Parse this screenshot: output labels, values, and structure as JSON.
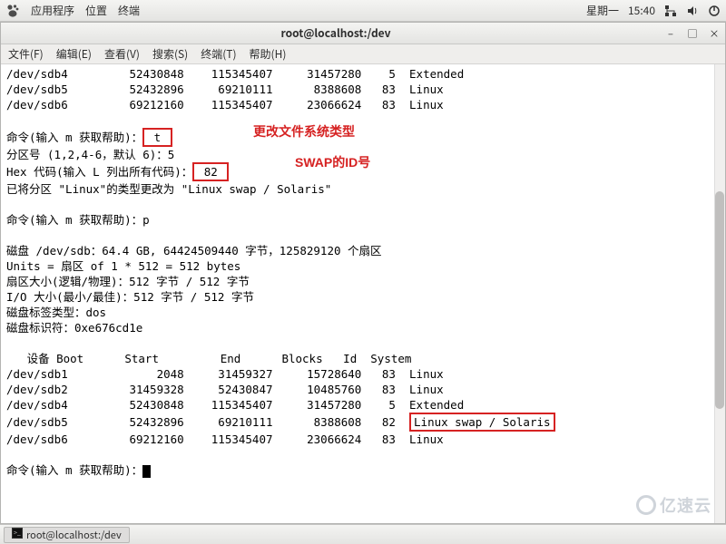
{
  "topbar": {
    "menus": [
      "应用程序",
      "位置",
      "终端"
    ],
    "day": "星期一",
    "time": "15:40"
  },
  "window": {
    "title": "root@localhost:/dev",
    "menubar": [
      "文件(F)",
      "编辑(E)",
      "查看(V)",
      "搜索(S)",
      "终端(T)",
      "帮助(H)"
    ]
  },
  "taskbar": {
    "item": "root@localhost:/dev"
  },
  "annotations": {
    "t_label": "更改文件系统类型",
    "id_label": "SWAP的ID号"
  },
  "terminal": {
    "partitions_top": [
      {
        "dev": "/dev/sdb4",
        "start": "52430848",
        "end": "115345407",
        "blocks": "31457280",
        "id": "5",
        "system": "Extended"
      },
      {
        "dev": "/dev/sdb5",
        "start": "52432896",
        "end": "69210111",
        "blocks": "8388608",
        "id": "83",
        "system": "Linux"
      },
      {
        "dev": "/dev/sdb6",
        "start": "69212160",
        "end": "115345407",
        "blocks": "23066624",
        "id": "83",
        "system": "Linux"
      }
    ],
    "cmd_prompt": "命令(输入 m 获取帮助)：",
    "input_t": "t",
    "part_num_prompt": "分区号 (1,2,4-6，默认 6)：5",
    "hex_prompt": "Hex 代码(输入 L 列出所有代码)：",
    "input_hex": "82",
    "changed_msg": "已将分区 \"Linux\"的类型更改为 \"Linux swap / Solaris\"",
    "input_p": "p",
    "disk_lines": [
      "磁盘 /dev/sdb：64.4 GB, 64424509440 字节，125829120 个扇区",
      "Units = 扇区 of 1 * 512 = 512 bytes",
      "扇区大小(逻辑/物理)：512 字节 / 512 字节",
      "I/O 大小(最小/最佳)：512 字节 / 512 字节",
      "磁盘标签类型：dos",
      "磁盘标识符：0xe676cd1e"
    ],
    "header": "   设备 Boot      Start         End      Blocks   Id  System",
    "partitions_bottom": [
      {
        "dev": "/dev/sdb1",
        "start": "2048",
        "end": "31459327",
        "blocks": "15728640",
        "id": "83",
        "system": "Linux"
      },
      {
        "dev": "/dev/sdb2",
        "start": "31459328",
        "end": "52430847",
        "blocks": "10485760",
        "id": "83",
        "system": "Linux"
      },
      {
        "dev": "/dev/sdb4",
        "start": "52430848",
        "end": "115345407",
        "blocks": "31457280",
        "id": "5",
        "system": "Extended"
      },
      {
        "dev": "/dev/sdb5",
        "start": "52432896",
        "end": "69210111",
        "blocks": "8388608",
        "id": "82",
        "system": "Linux swap / Solaris",
        "highlight": true
      },
      {
        "dev": "/dev/sdb6",
        "start": "69212160",
        "end": "115345407",
        "blocks": "23066624",
        "id": "83",
        "system": "Linux"
      }
    ]
  },
  "watermark": "亿速云"
}
